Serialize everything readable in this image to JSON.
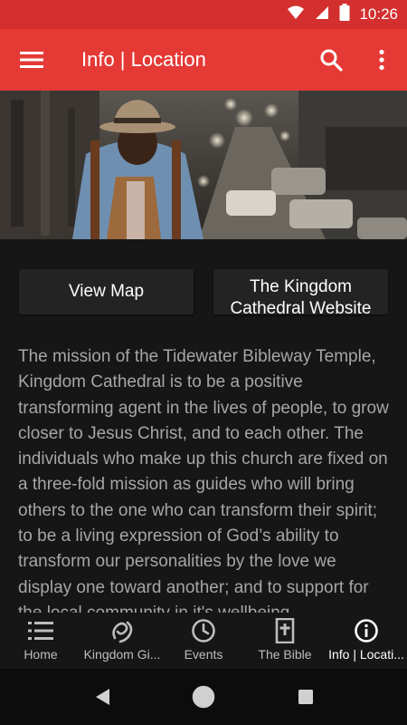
{
  "status": {
    "time": "10:26"
  },
  "app_bar": {
    "title": "Info | Location"
  },
  "buttons": {
    "view_map": "View Map",
    "website": "The Kingdom Cathedral Website"
  },
  "mission_text": "The mission of the Tidewater Bibleway Temple, Kingdom Cathedral is to be a positive transforming agent in the lives of people, to grow closer to Jesus Christ, and to each other. The individuals who make up this church are fixed on a three-fold mission as guides who will bring others to the one who can transform their spirit; to be a living expression of God’s ability to transform our personalities by the love we display one toward another; and to support for the local community in it's wellbeing.",
  "bottom_nav": [
    {
      "label": "Home",
      "icon": "list-icon",
      "active": false
    },
    {
      "label": "Kingdom Gi...",
      "icon": "giving-icon",
      "active": false
    },
    {
      "label": "Events",
      "icon": "clock-icon",
      "active": false
    },
    {
      "label": "The Bible",
      "icon": "bible-icon",
      "active": false
    },
    {
      "label": "Info | Locati...",
      "icon": "info-icon",
      "active": true
    }
  ],
  "colors": {
    "status_bar": "#d32f2f",
    "app_bar": "#e53935",
    "background": "#161616",
    "button": "#232323",
    "body_text": "#a6a6a6"
  }
}
